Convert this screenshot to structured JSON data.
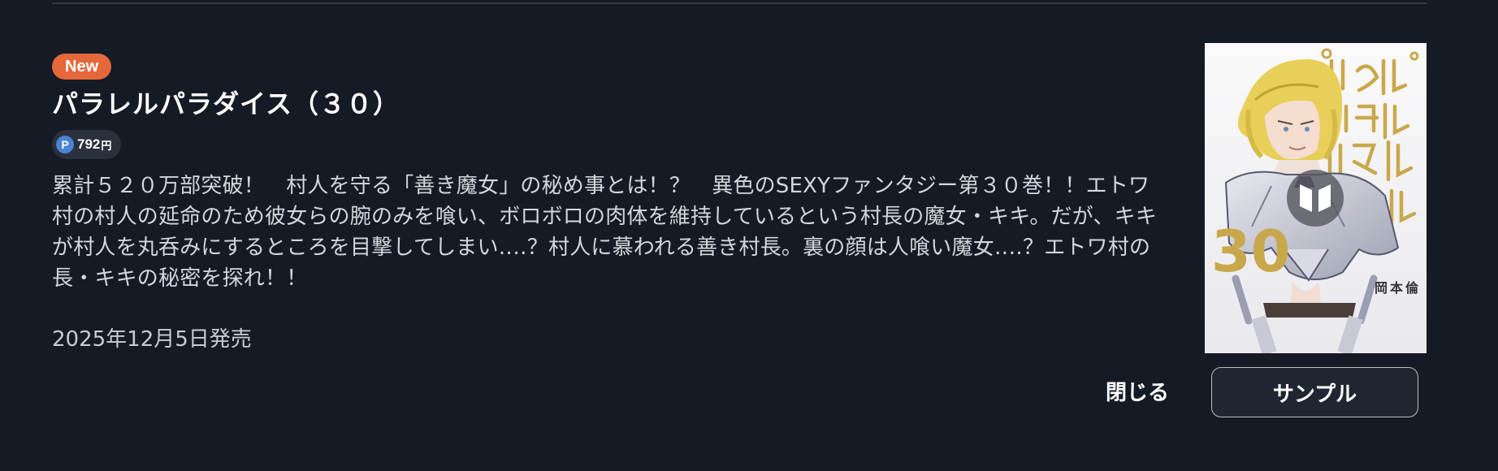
{
  "product": {
    "badge": "New",
    "title": "パラレルパラダイス（３０）",
    "point_icon_label": "P",
    "price": "792",
    "currency": "円",
    "description": "累計５２０万部突破！　村人を守る「善き魔女」の秘め事とは！？　異色のSEXYファンタジー第３０巻！！エトワ村の村人の延命のため彼女らの腕のみを喰い、ボロボロの肉体を維持しているという村長の魔女・キキ。だが、キキが村人を丸呑みにするところを目撃してしまい‥‥？村人に慕われる善き村長。裏の顔は人喰い魔女‥‥？エトワ村の長・キキの秘密を探れ！！",
    "release_date": "2025年12月5日発売"
  },
  "cover": {
    "series_title": "パラレルパラダイス",
    "volume": "30",
    "author": "岡本倫",
    "play_icon": "book-preview-icon"
  },
  "actions": {
    "close_label": "閉じる",
    "sample_label": "サンプル"
  },
  "colors": {
    "background": "#151b24",
    "badge": "#e5673a",
    "point": "#4a84d7",
    "cover_gold": "#c9a84c"
  }
}
